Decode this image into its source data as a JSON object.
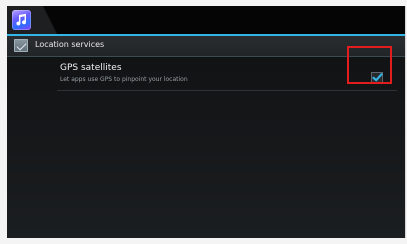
{
  "app": {
    "icon": "music-note-icon"
  },
  "header": {
    "icon": "location-services-icon",
    "title": "Location services"
  },
  "settings": [
    {
      "title": "GPS satellites",
      "summary": "Let apps use GPS to pinpoint your location",
      "checked": true
    }
  ],
  "colors": {
    "accent": "#33b5e5",
    "highlight": "#e11d1d",
    "background": "#141618"
  }
}
